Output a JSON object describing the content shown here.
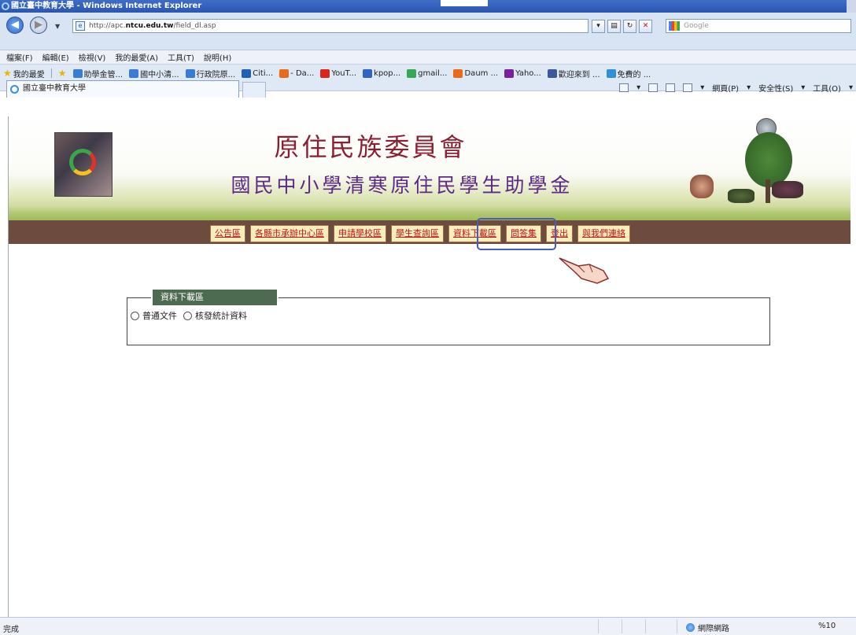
{
  "window": {
    "title": "國立臺中教育大學 - Windows Internet Explorer"
  },
  "address_bar": {
    "url_prefix": "http://apc.",
    "url_domain": "ntcu.edu.tw",
    "url_path": "/field_dl.asp",
    "search_placeholder": "Google"
  },
  "menu": [
    "檔案(F)",
    "編輯(E)",
    "檢視(V)",
    "我的最愛(A)",
    "工具(T)",
    "說明(H)"
  ],
  "favorites": {
    "label": "我的最愛",
    "items": [
      {
        "label": "助學金管...",
        "icon": "ie-page-icon",
        "color": "#3a7bd5"
      },
      {
        "label": "國中小清...",
        "icon": "ie-page-icon",
        "color": "#3a7bd5"
      },
      {
        "label": "行政院原...",
        "icon": "ie-page-icon",
        "color": "#3a7bd5"
      },
      {
        "label": "Citi...",
        "icon": "citi-icon",
        "color": "#1f5fb8"
      },
      {
        "label": "- Da...",
        "icon": "daum-icon",
        "color": "#e86a1a"
      },
      {
        "label": "YouT...",
        "icon": "youtube-icon",
        "color": "#d8261c"
      },
      {
        "label": "kpop...",
        "icon": "kpop-icon",
        "color": "#2f63c8"
      },
      {
        "label": "gmail...",
        "icon": "gmail-icon",
        "color": "#34a853"
      },
      {
        "label": "Daum ...",
        "icon": "daum-icon",
        "color": "#e86a1a"
      },
      {
        "label": "Yaho...",
        "icon": "yahoo-icon",
        "color": "#7b1fa2"
      },
      {
        "label": "歡迎來到 ...",
        "icon": "facebook-icon",
        "color": "#3b5998"
      },
      {
        "label": "免費的 ...",
        "icon": "hotmail-icon",
        "color": "#2f8fd8"
      }
    ]
  },
  "tab": {
    "label": "國立臺中教育大學"
  },
  "command_bar": {
    "page": "網頁(P)",
    "safety": "安全性(S)",
    "tools": "工具(O)"
  },
  "page": {
    "title_main": "原住民族委員會",
    "title_sub": "國民中小學清寒原住民學生助學金",
    "nav": [
      "公告區",
      "各縣市承辦中心區",
      "申請學校區",
      "學生查詢區",
      "資料下載區",
      "問答集",
      "登出",
      "與我們連絡"
    ],
    "highlighted_nav_index": 4,
    "section": {
      "legend": "資料下載區",
      "options": [
        "普通文件",
        "核發統計資料"
      ]
    }
  },
  "status": {
    "left": "完成",
    "zone": "網際網路",
    "zoom": "%10"
  },
  "colors": {
    "title_main": "#8a1f32",
    "title_sub": "#5b2a86",
    "nav_bar": "#6e4b3f",
    "nav_text": "#c0141a",
    "legend_bg": "#4d6b50",
    "highlight_box": "#4c5bb8"
  }
}
